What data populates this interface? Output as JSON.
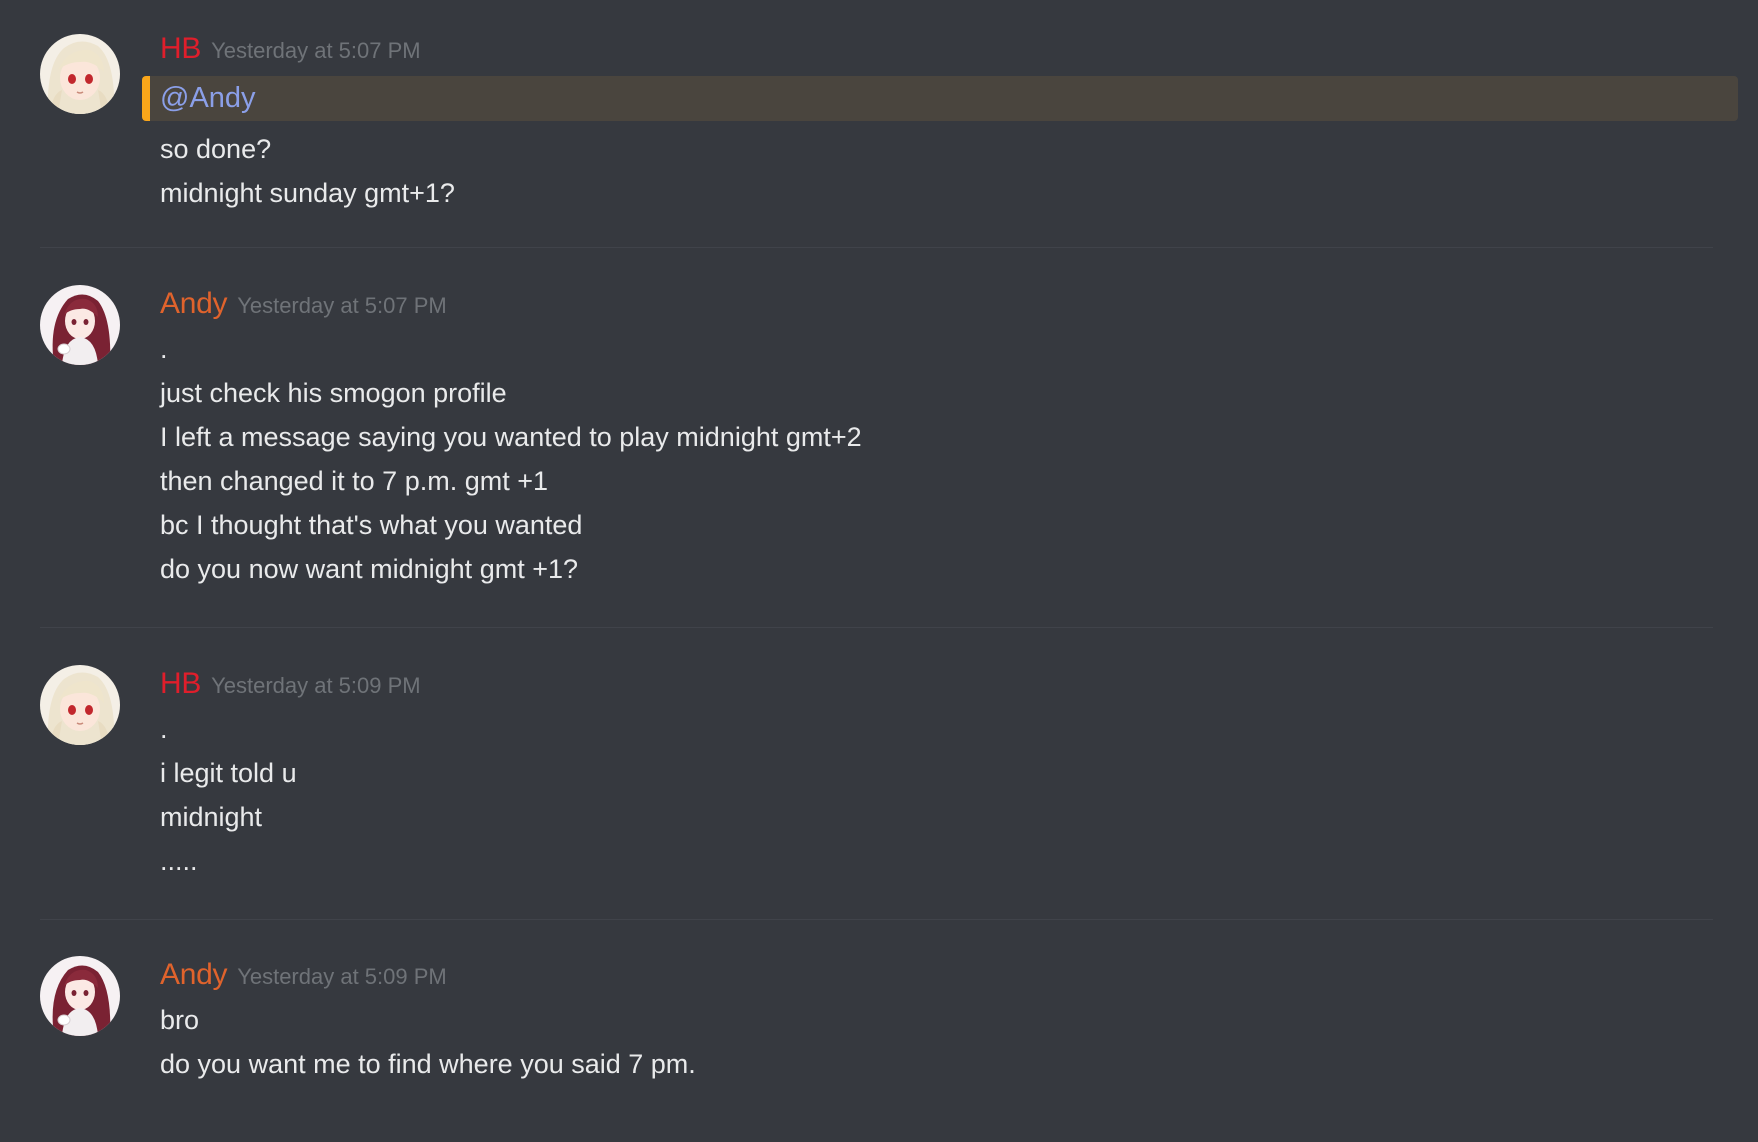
{
  "messages": [
    {
      "username": "HB",
      "timestamp": "Yesterday at 5:07 PM",
      "mention": "@Andy",
      "lines": [
        "so done?",
        "midnight sunday gmt+1?"
      ]
    },
    {
      "username": "Andy",
      "timestamp": "Yesterday at 5:07 PM",
      "lines": [
        ".",
        "just check his smogon profile",
        "I left a message saying you wanted to play midnight gmt+2",
        "then changed it to 7 p.m. gmt +1",
        "bc I thought that's what you wanted",
        "do you now want midnight gmt +1?"
      ]
    },
    {
      "username": "HB",
      "timestamp": "Yesterday at 5:09 PM",
      "lines": [
        ".",
        "i legit told u",
        "midnight",
        "....."
      ]
    },
    {
      "username": "Andy",
      "timestamp": "Yesterday at 5:09 PM",
      "lines": [
        "bro",
        "do you want me to find where you said 7 pm."
      ]
    }
  ],
  "colors": {
    "background": "#36393f",
    "hb_name": "#e01e2b",
    "andy_name": "#e0632c",
    "mention_text": "#8b9fe8",
    "mention_bar": "#faa61a",
    "mention_bg": "#4a453e"
  },
  "icons": {
    "hb_avatar": "hb-avatar-icon",
    "andy_avatar": "andy-avatar-icon"
  }
}
